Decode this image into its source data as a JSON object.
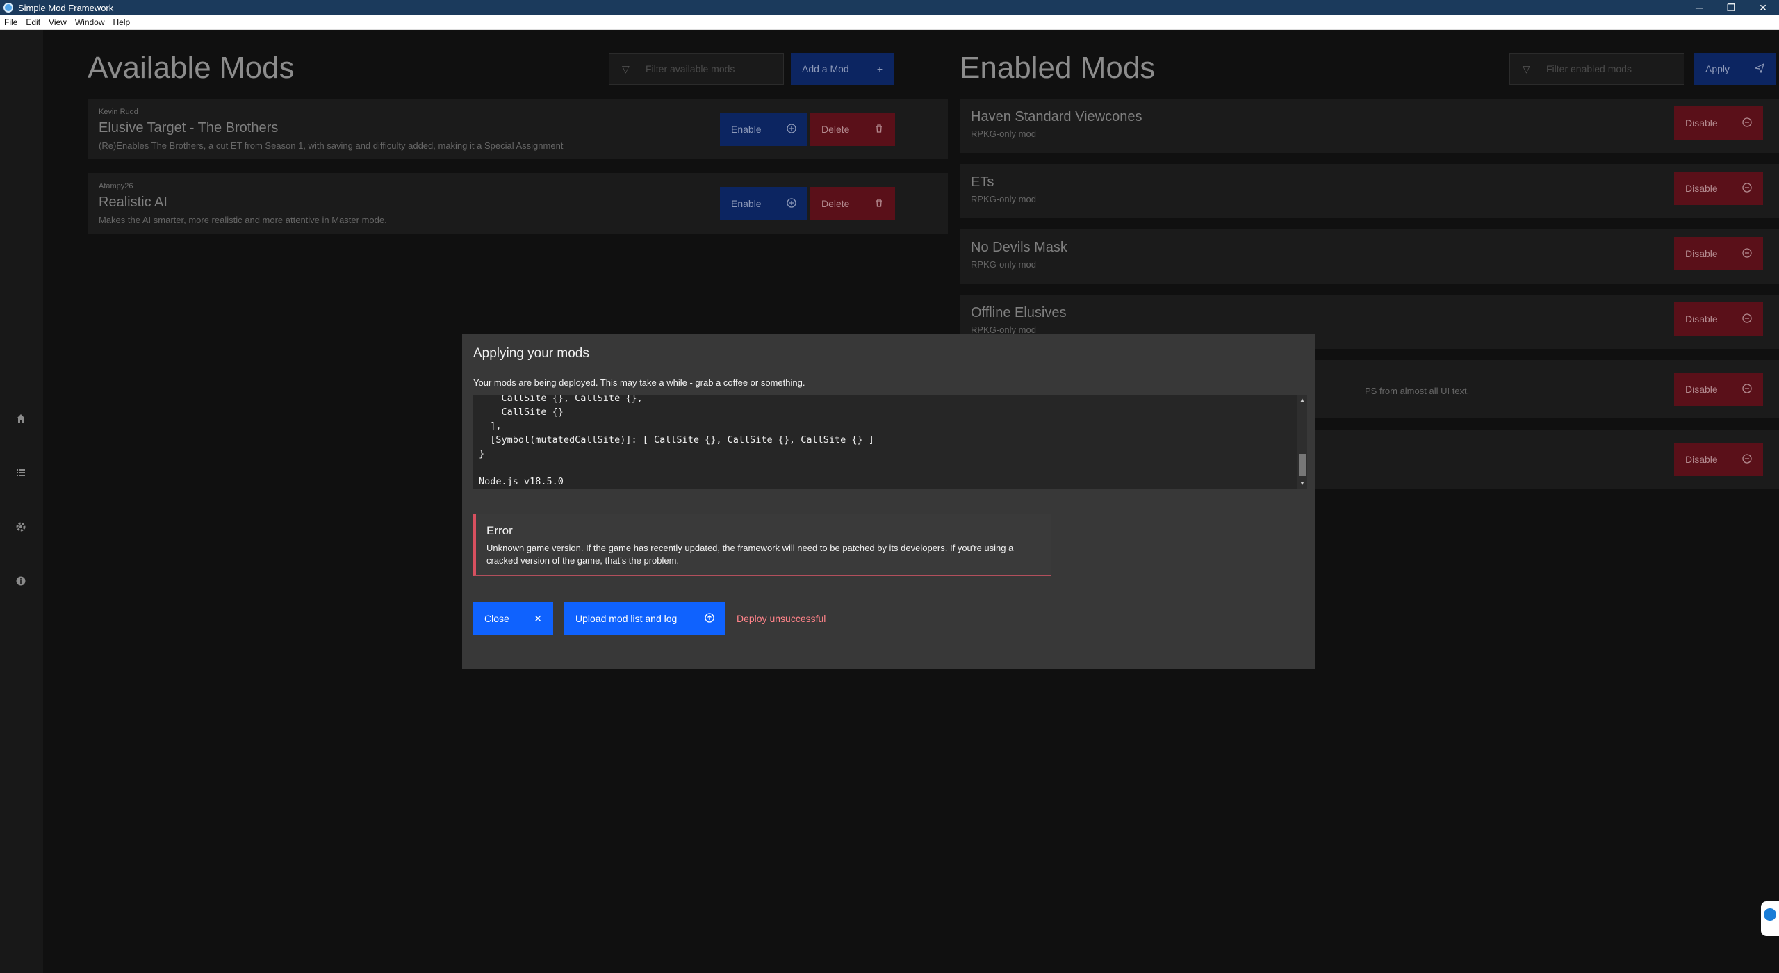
{
  "window": {
    "title": "Simple Mod Framework",
    "minimize": "─",
    "maximize": "❐",
    "close": "✕"
  },
  "menu": [
    "File",
    "Edit",
    "View",
    "Window",
    "Help"
  ],
  "sidebar": {
    "icons": [
      "home-icon",
      "list-icon",
      "settings-icon",
      "info-icon"
    ]
  },
  "available": {
    "heading": "Available Mods",
    "filter_placeholder": "Filter available mods",
    "add_label": "Add a Mod",
    "add_icon": "+",
    "mods": [
      {
        "author": "Kevin Rudd",
        "name": "Elusive Target - The Brothers",
        "description": "(Re)Enables The Brothers, a cut ET from Season 1, with saving and difficulty added, making it a Special Assignment",
        "enable_label": "Enable",
        "delete_label": "Delete"
      },
      {
        "author": "Atampy26",
        "name": "Realistic AI",
        "description": "Makes the AI smarter, more realistic and more attentive in Master mode.",
        "enable_label": "Enable",
        "delete_label": "Delete"
      }
    ]
  },
  "enabled": {
    "heading": "Enabled Mods",
    "filter_placeholder": "Filter enabled mods",
    "apply_label": "Apply",
    "mods": [
      {
        "name": "Haven Standard Viewcones",
        "description": "RPKG-only mod",
        "disable_label": "Disable"
      },
      {
        "name": "ETs",
        "description": "RPKG-only mod",
        "disable_label": "Disable"
      },
      {
        "name": "No Devils Mask",
        "description": "RPKG-only mod",
        "disable_label": "Disable"
      },
      {
        "name": "Offline Elusives",
        "description": "RPKG-only mod",
        "disable_label": "Disable"
      },
      {
        "name": "",
        "description": "PS from almost all UI text.",
        "disable_label": "Disable"
      },
      {
        "name": "",
        "description": "",
        "disable_label": "Disable"
      }
    ]
  },
  "modal": {
    "title": "Applying your mods",
    "subtitle": "Your mods are being deployed. This may take a while - grab a coffee or something.",
    "log": "    CallSite {}, CallSite {},\n    CallSite {}\n  ],\n  [Symbol(mutatedCallSite)]: [ CallSite {}, CallSite {}, CallSite {} ]\n}\n\nNode.js v18.5.0",
    "error_title": "Error",
    "error_message": "Unknown game version. If the game has recently updated, the framework will need to be patched by its developers. If you're using a cracked version of the game, that's the problem.",
    "close_label": "Close",
    "close_icon": "✕",
    "upload_label": "Upload mod list and log",
    "upload_icon": "⇧",
    "status": "Deploy unsuccessful"
  }
}
